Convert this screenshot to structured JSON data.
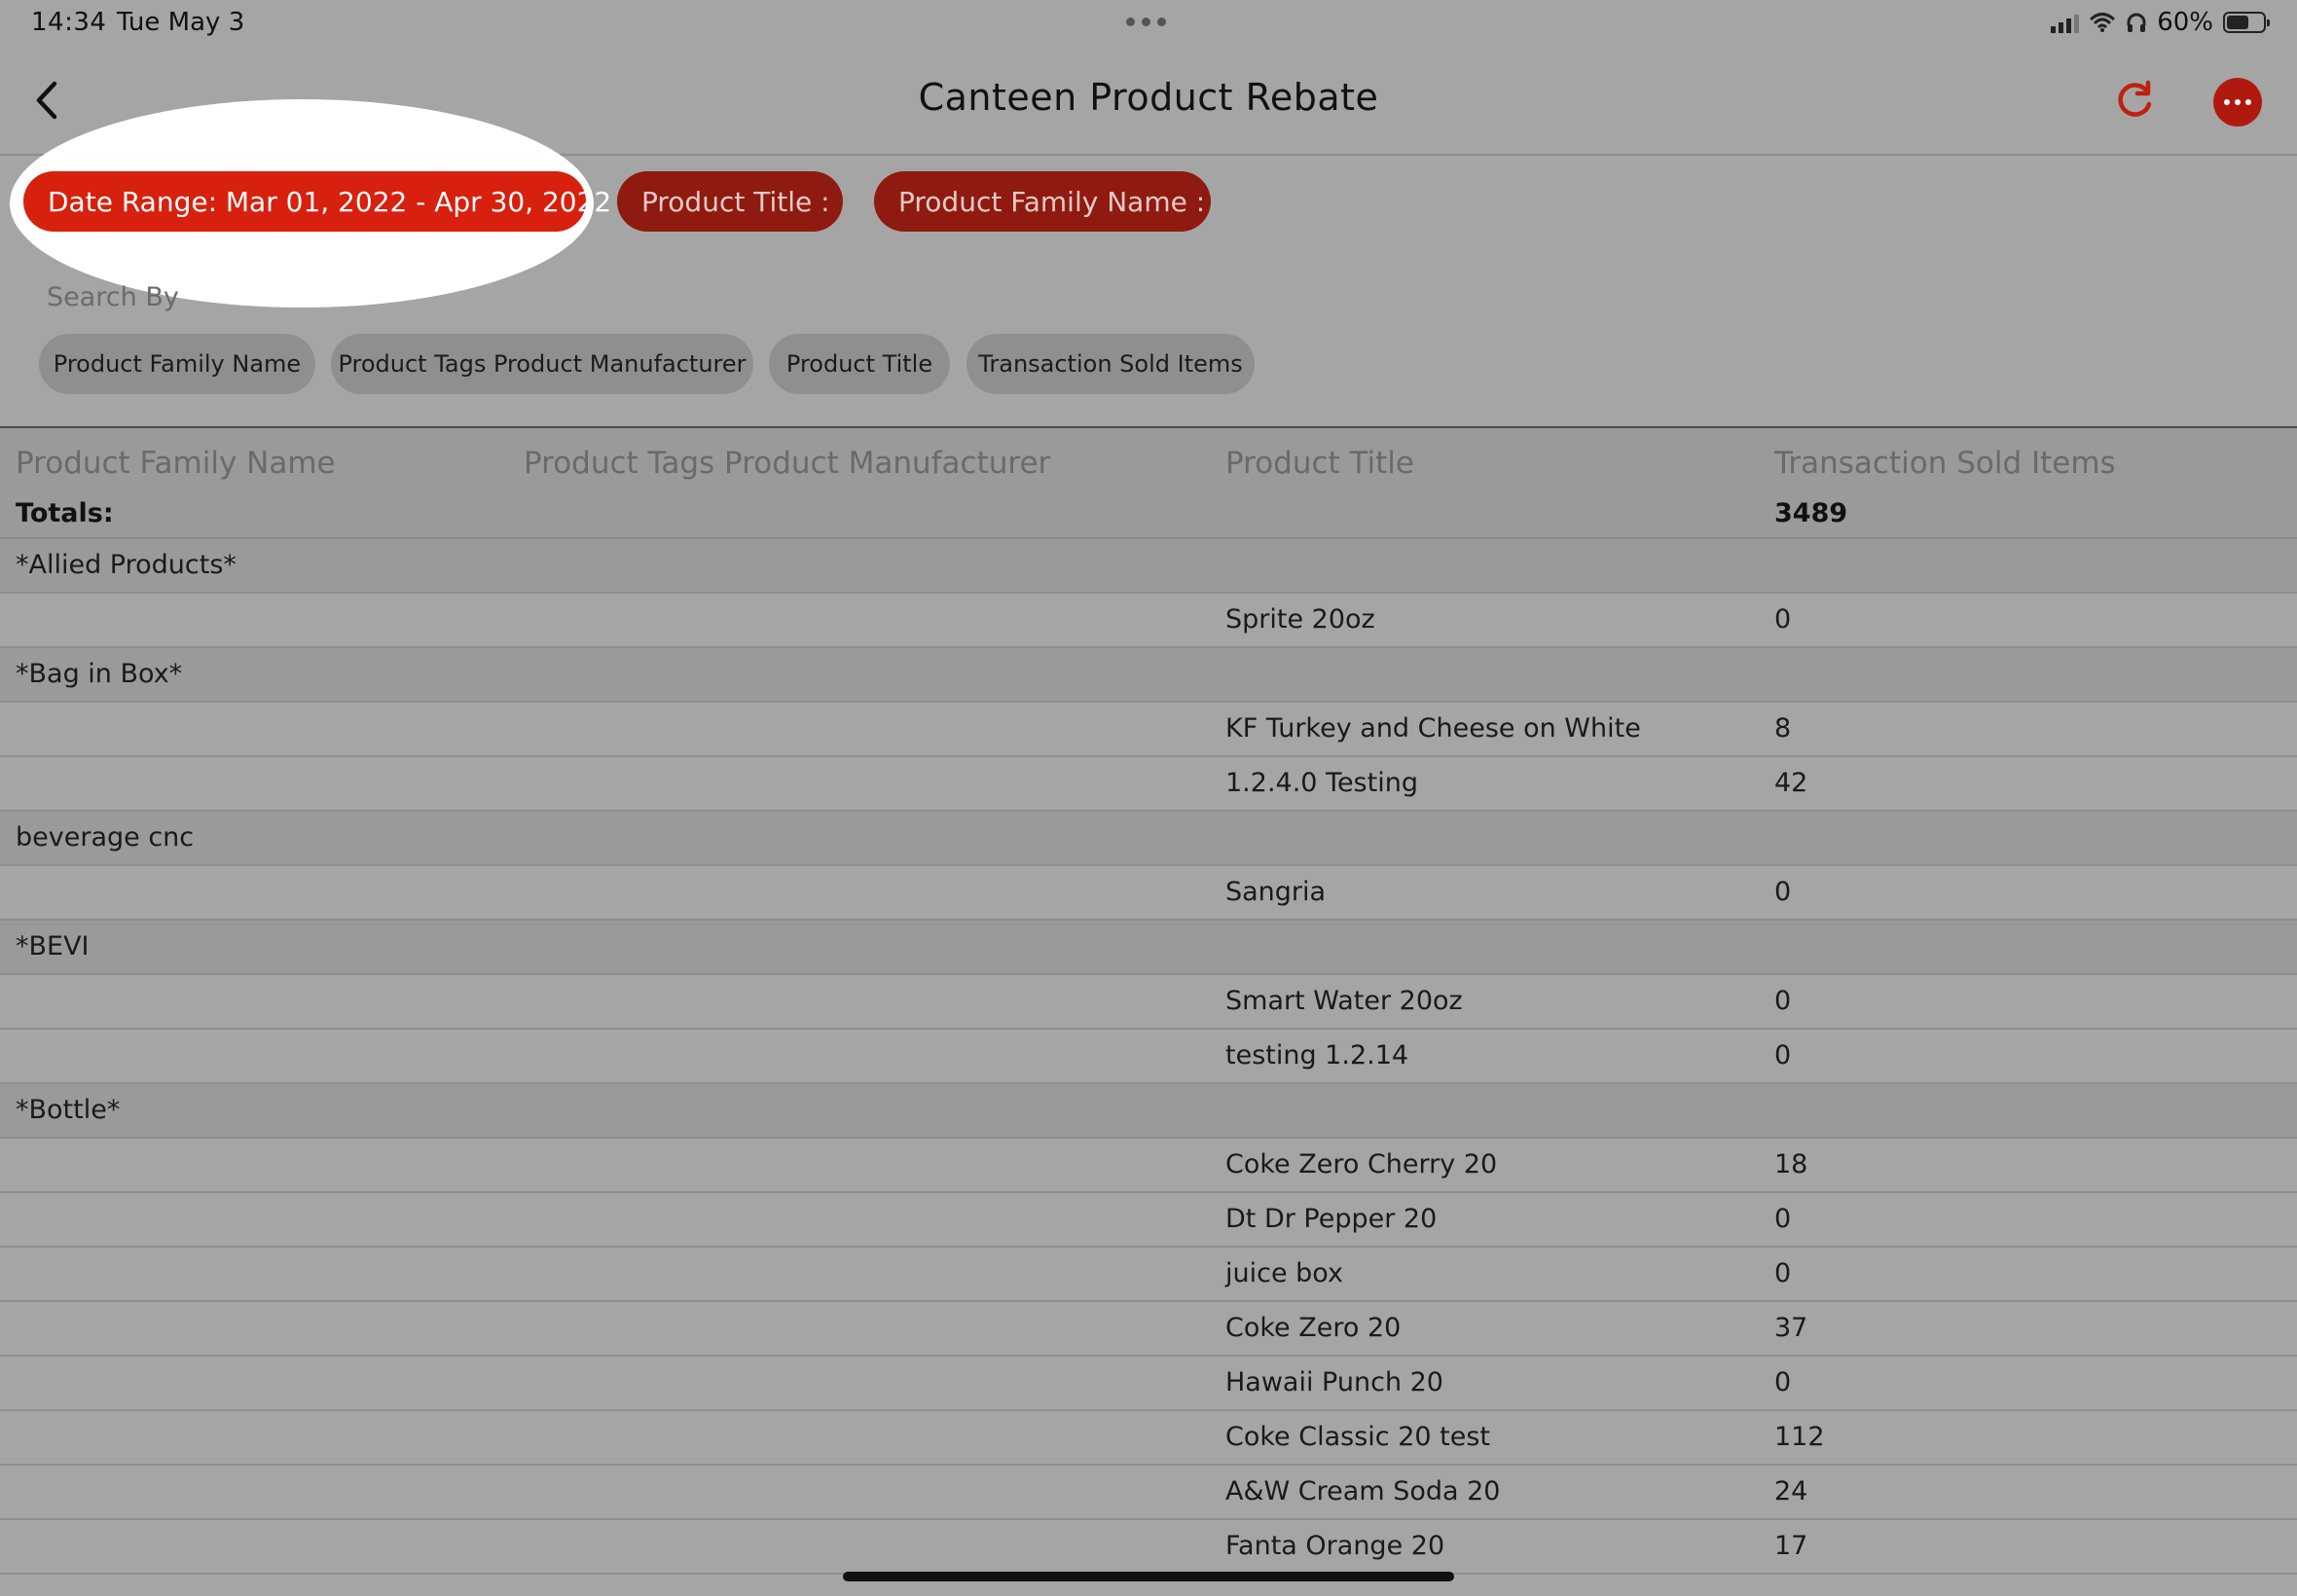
{
  "status": {
    "time": "14:34",
    "date": "Tue May 3",
    "battery": "60%",
    "battery_level": 0.6
  },
  "nav": {
    "title": "Canteen Product Rebate"
  },
  "filters": {
    "date_range": "Date Range: Mar 01, 2022 - Apr 30, 2022",
    "product_title": "Product Title :",
    "product_family": "Product Family Name :"
  },
  "search": {
    "label": "Search By",
    "options": [
      "Product Family Name",
      "Product Tags Product Manufacturer",
      "Product Title",
      "Transaction Sold Items"
    ]
  },
  "table": {
    "headers": [
      "Product Family Name",
      "Product Tags Product Manufacturer",
      "Product Title",
      "Transaction Sold Items"
    ],
    "totals_label": "Totals:",
    "totals_value": "3489",
    "rows": [
      {
        "type": "group",
        "family": "*Allied Products*"
      },
      {
        "type": "item",
        "title": "Sprite 20oz",
        "sold": "0"
      },
      {
        "type": "group",
        "family": "*Bag in Box*"
      },
      {
        "type": "item",
        "title": "KF Turkey and Cheese on White",
        "sold": "8"
      },
      {
        "type": "item",
        "title": "1.2.4.0 Testing",
        "sold": "42"
      },
      {
        "type": "group",
        "family": "beverage cnc"
      },
      {
        "type": "item",
        "title": "Sangria",
        "sold": "0"
      },
      {
        "type": "group",
        "family": "*BEVI"
      },
      {
        "type": "item",
        "title": "Smart Water 20oz",
        "sold": "0"
      },
      {
        "type": "item",
        "title": "testing 1.2.14",
        "sold": "0"
      },
      {
        "type": "group",
        "family": "*Bottle*"
      },
      {
        "type": "item",
        "title": "Coke Zero Cherry 20",
        "sold": "18"
      },
      {
        "type": "item",
        "title": "Dt Dr Pepper 20",
        "sold": "0"
      },
      {
        "type": "item",
        "title": "juice box",
        "sold": "0"
      },
      {
        "type": "item",
        "title": "Coke Zero 20",
        "sold": "37"
      },
      {
        "type": "item",
        "title": "Hawaii Punch 20",
        "sold": "0"
      },
      {
        "type": "item",
        "title": "Coke Classic 20 test",
        "sold": "112"
      },
      {
        "type": "item",
        "title": "A&W Cream Soda 20",
        "sold": "24"
      },
      {
        "type": "item",
        "title": "Fanta Orange 20",
        "sold": "17"
      }
    ]
  }
}
